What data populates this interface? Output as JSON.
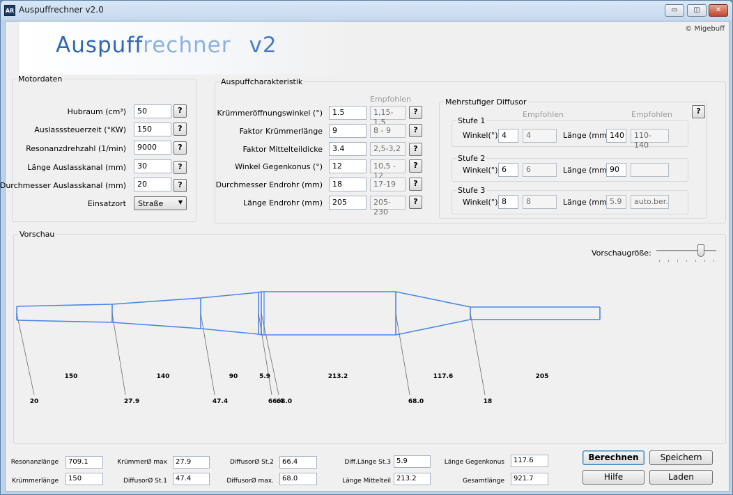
{
  "window": {
    "title": "Auspuffrechner v2.0",
    "icon_text": "AR",
    "minimize_icon": "minimize-icon",
    "maximize_icon": "maximize-icon",
    "close_icon": "close-icon"
  },
  "logo": {
    "part1": "Auspuff",
    "part2": "rechner",
    "version": "v2"
  },
  "copyright": "© Migebuff",
  "motordaten": {
    "title": "Motordaten",
    "hubraum": {
      "label": "Hubraum (cm³)",
      "value": "50"
    },
    "auslasssteuerzeit": {
      "label": "Auslasssteuerzeit (°KW)",
      "value": "150"
    },
    "resonanzdrehzahl": {
      "label": "Resonanzdrehzahl (1/min)",
      "value": "9000"
    },
    "laenge_auslasskanal": {
      "label": "Länge Auslasskanal (mm)",
      "value": "30"
    },
    "durchmesser_auslasskanal": {
      "label": "Durchmesser Auslasskanal (mm)",
      "value": "20"
    },
    "einsatzort": {
      "label": "Einsatzort",
      "value": "Straße"
    },
    "help": "?"
  },
  "auspuff": {
    "title": "Auspuffcharakteristik",
    "empfohlen": "Empfohlen",
    "rows": [
      {
        "label": "Krümmeröffnungswinkel (°)",
        "value": "1.5",
        "rec": "1,15-1,5"
      },
      {
        "label": "Faktor Krümmerlänge",
        "value": "9",
        "rec": "8 - 9"
      },
      {
        "label": "Faktor Mittelteildicke",
        "value": "3.4",
        "rec": "2,5-3,2"
      },
      {
        "label": "Winkel Gegenkonus (°)",
        "value": "12",
        "rec": "10,5 - 12"
      },
      {
        "label": "Durchmesser Endrohr (mm)",
        "value": "18",
        "rec": "17-19"
      },
      {
        "label": "Länge Endrohr (mm)",
        "value": "205",
        "rec": "205-230"
      }
    ]
  },
  "diffusor": {
    "title": "Mehrstufiger Diffusor",
    "empfohlen": "Empfohlen",
    "winkel_label": "Winkel(°)",
    "laenge_label": "Länge (mm)",
    "stufen": [
      {
        "title": "Stufe 1",
        "winkel": "4",
        "winkel_rec": "4",
        "laenge": "140",
        "laenge_rec": "110-140"
      },
      {
        "title": "Stufe 2",
        "winkel": "6",
        "winkel_rec": "6",
        "laenge": "90",
        "laenge_rec": ""
      },
      {
        "title": "Stufe 3",
        "winkel": "8",
        "winkel_rec": "8",
        "laenge": "5.9",
        "laenge_rec": "auto.ber."
      }
    ]
  },
  "vorschau": {
    "title": "Vorschau",
    "groesse_label": "Vorschaugröße:",
    "slider_value_percent": 78,
    "lengths": [
      "150",
      "140",
      "90",
      "5.9",
      "213.2",
      "117.6",
      "205"
    ],
    "diameters": [
      "20",
      "27.9",
      "47.4",
      "66.4",
      "68.0",
      "68.0",
      "18"
    ]
  },
  "results": {
    "resonanzlaenge": {
      "label": "Resonanzlänge",
      "value": "709.1"
    },
    "kruemmerlaenge": {
      "label": "Krümmerlänge",
      "value": "150"
    },
    "kruemmer_max": {
      "label": "KrümmerØ max",
      "value": "27.9"
    },
    "diffusor_st1": {
      "label": "DiffusorØ St.1",
      "value": "47.4"
    },
    "diffusor_st2": {
      "label": "DiffusorØ St.2",
      "value": "66.4"
    },
    "diffusor_max": {
      "label": "DiffusorØ max.",
      "value": "68.0"
    },
    "diff_laenge_st3": {
      "label": "Diff.Länge St.3",
      "value": "5.9"
    },
    "laenge_mittelteil": {
      "label": "Länge Mittelteil",
      "value": "213.2"
    },
    "laenge_gegenkonus": {
      "label": "Länge Gegenkonus",
      "value": "117.6"
    },
    "gesamtlaenge": {
      "label": "Gesamtlänge",
      "value": "921.7"
    }
  },
  "buttons": {
    "berechnen": "Berechnen",
    "speichern": "Speichern",
    "hilfe": "Hilfe",
    "laden": "Laden"
  },
  "colors": {
    "pipe": "#4a86e8",
    "leader": "#6b6b6b"
  }
}
